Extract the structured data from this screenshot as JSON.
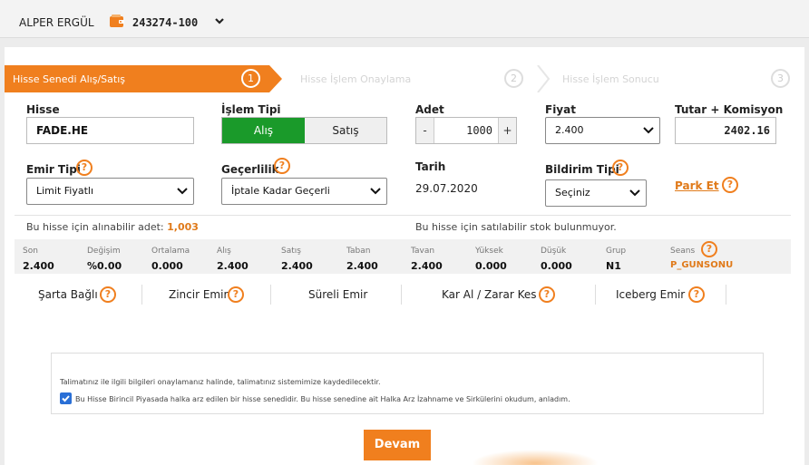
{
  "header": {
    "user_name": "ALPER ERGÜL",
    "account_no": "243274-100"
  },
  "steps": [
    {
      "label": "Hisse Senedi Alış/Satış",
      "number": "1",
      "active": true
    },
    {
      "label": "Hisse İşlem Onaylama",
      "number": "2",
      "active": false
    },
    {
      "label": "Hisse İşlem Sonucu",
      "number": "3",
      "active": false
    }
  ],
  "form": {
    "stock_label": "Hisse",
    "stock_value": "FADE.HE",
    "txn_type_label": "İşlem Tipi",
    "buy_label": "Alış",
    "sell_label": "Satış",
    "qty_label": "Adet",
    "qty_minus": "-",
    "qty_plus": "+",
    "qty_value": "1000",
    "price_label": "Fiyat",
    "price_value": "2.400",
    "total_label": "Tutar + Komisyon",
    "total_value": "2402.16",
    "order_type_label": "Emir Tipi",
    "order_type_value": "Limit Fiyatlı",
    "validity_label": "Geçerlilik",
    "validity_value": "İptale Kadar Geçerli",
    "date_label": "Tarih",
    "date_value": "29.07.2020",
    "notify_label": "Bildirim Tipi",
    "notify_value": "Seçiniz",
    "park_label": "Park Et",
    "help_glyph": "?"
  },
  "info": {
    "buyable_text": "Bu hisse için alınabilir adet:",
    "buyable_value": "1,003",
    "sellable_text": "Bu hisse için satılabilir stok bulunmuyor."
  },
  "stats": [
    {
      "label": "Son",
      "value": "2.400"
    },
    {
      "label": "Değişim",
      "value": "%0.00"
    },
    {
      "label": "Ortalama",
      "value": "0.000"
    },
    {
      "label": "Alış",
      "value": "2.400"
    },
    {
      "label": "Satış",
      "value": "2.400"
    },
    {
      "label": "Taban",
      "value": "2.400"
    },
    {
      "label": "Tavan",
      "value": "2.400"
    },
    {
      "label": "Yüksek",
      "value": "0.000"
    },
    {
      "label": "Düşük",
      "value": "0.000"
    },
    {
      "label": "Grup",
      "value": "N1"
    },
    {
      "label": "Seans",
      "value": "P_GUNSONU"
    }
  ],
  "order_tabs": [
    {
      "label": "Şarta Bağlı"
    },
    {
      "label": "Zincir Emir"
    },
    {
      "label": "Süreli Emir"
    },
    {
      "label": "Kar Al / Zarar Kes"
    },
    {
      "label": "Iceberg Emir"
    }
  ],
  "notice": {
    "line1": "Talimatınız ile ilgili bilgileri onaylamanız halinde, talimatınız sistemimize kaydedilecektir.",
    "checkbox_text": "Bu Hisse Birincil Piyasada halka arz edilen bir hisse senedidir. Bu hisse senedine ait Halka Arz İzahname ve Sirkülerini okudum, anladım.",
    "checked": true
  },
  "actions": {
    "continue_label": "Devam"
  },
  "colors": {
    "accent": "#f07f1e",
    "buy_green": "#1a9a2a"
  }
}
